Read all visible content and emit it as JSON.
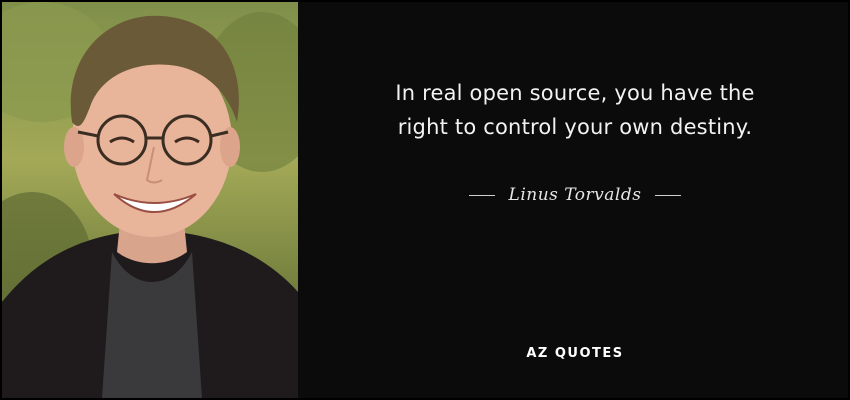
{
  "quote": {
    "lines": [
      "In real open source, you have the",
      "right to control your own destiny."
    ]
  },
  "author": {
    "name": "Linus Torvalds"
  },
  "brand": {
    "logo_text": "AZ QUOTES"
  },
  "colors": {
    "background": "#0b0b0b",
    "text": "#f2f2f2",
    "border": "#000000"
  },
  "photo": {
    "subject": "portrait-photo"
  }
}
